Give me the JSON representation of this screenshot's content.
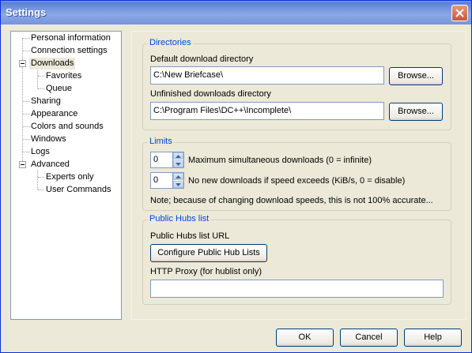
{
  "window": {
    "title": "Settings"
  },
  "tree": {
    "items": [
      "Personal information",
      "Connection settings",
      "Downloads",
      "Favorites",
      "Queue",
      "Sharing",
      "Appearance",
      "Colors and sounds",
      "Windows",
      "Logs",
      "Advanced",
      "Experts only",
      "User Commands"
    ],
    "selected": "Downloads"
  },
  "directories": {
    "legend": "Directories",
    "default_label": "Default download directory",
    "default_value": "C:\\New Briefcase\\",
    "unfinished_label": "Unfinished downloads directory",
    "unfinished_value": "C:\\Program Files\\DC++\\Incomplete\\",
    "browse_label": "Browse..."
  },
  "limits": {
    "legend": "Limits",
    "max_downloads_value": "0",
    "max_downloads_label": "Maximum simultaneous downloads (0 = infinite)",
    "speed_value": "0",
    "speed_label": "No new downloads if speed exceeds (KiB/s, 0 = disable)",
    "note": "Note; because of changing download speeds, this is not 100% accurate..."
  },
  "hubs": {
    "legend": "Public Hubs list",
    "url_label": "Public Hubs list URL",
    "configure_button": "Configure Public Hub Lists",
    "proxy_label": "HTTP Proxy (for hublist only)",
    "proxy_value": ""
  },
  "footer": {
    "ok": "OK",
    "cancel": "Cancel",
    "help": "Help"
  }
}
